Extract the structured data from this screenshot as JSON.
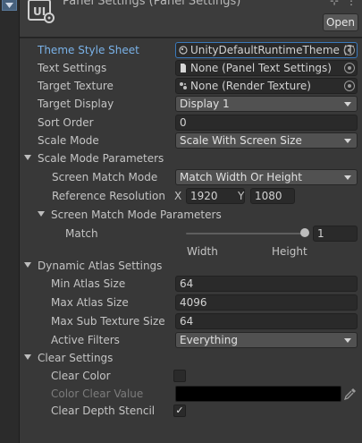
{
  "header": {
    "title": "Panel Settings (Panel Settings)",
    "header_icons": "⊹ ⋮",
    "open_label": "Open"
  },
  "properties": {
    "theme_style_sheet": {
      "label": "Theme Style Sheet",
      "value": "UnityDefaultRuntimeTheme (T"
    },
    "text_settings": {
      "label": "Text Settings",
      "value": "None (Panel Text Settings)"
    },
    "target_texture": {
      "label": "Target Texture",
      "value": "None (Render Texture)"
    },
    "target_display": {
      "label": "Target Display",
      "value": "Display 1"
    },
    "sort_order": {
      "label": "Sort Order",
      "value": "0"
    },
    "scale_mode": {
      "label": "Scale Mode",
      "value": "Scale With Screen Size"
    }
  },
  "scale_mode_parameters": {
    "label": "Scale Mode Parameters",
    "screen_match_mode": {
      "label": "Screen Match Mode",
      "value": "Match Width Or Height"
    },
    "reference_resolution": {
      "label": "Reference Resolution",
      "x_label": "X",
      "x": "1920",
      "y_label": "Y",
      "y": "1080"
    },
    "screen_match_mode_parameters": {
      "label": "Screen Match Mode Parameters",
      "match": {
        "label": "Match",
        "value": "1",
        "fraction": 1,
        "min_label": "Width",
        "max_label": "Height"
      }
    }
  },
  "dynamic_atlas_settings": {
    "label": "Dynamic Atlas Settings",
    "min_atlas_size": {
      "label": "Min Atlas Size",
      "value": "64"
    },
    "max_atlas_size": {
      "label": "Max Atlas Size",
      "value": "4096"
    },
    "max_sub_texture_size": {
      "label": "Max Sub Texture Size",
      "value": "64"
    },
    "active_filters": {
      "label": "Active Filters",
      "value": "Everything"
    }
  },
  "clear_settings": {
    "label": "Clear Settings",
    "clear_color": {
      "label": "Clear Color",
      "checked": false
    },
    "color_clear_value": {
      "label": "Color Clear Value",
      "color": "#000000"
    },
    "clear_depth_stencil": {
      "label": "Clear Depth Stencil",
      "checked": true,
      "check_glyph": "✓"
    }
  },
  "colors": {
    "accent_label": "#7ab2e8",
    "highlight_border": "#3a79bb",
    "panel_bg": "#383838",
    "header_bg": "#3c3c3c"
  },
  "icons": {
    "asset": "ui-panel-settings-icon",
    "theme": "style-sheet-icon",
    "text_settings": "document-icon",
    "target_texture": "render-texture-icon",
    "picker": "object-picker-icon",
    "eyedropper": "eyedropper-icon"
  }
}
